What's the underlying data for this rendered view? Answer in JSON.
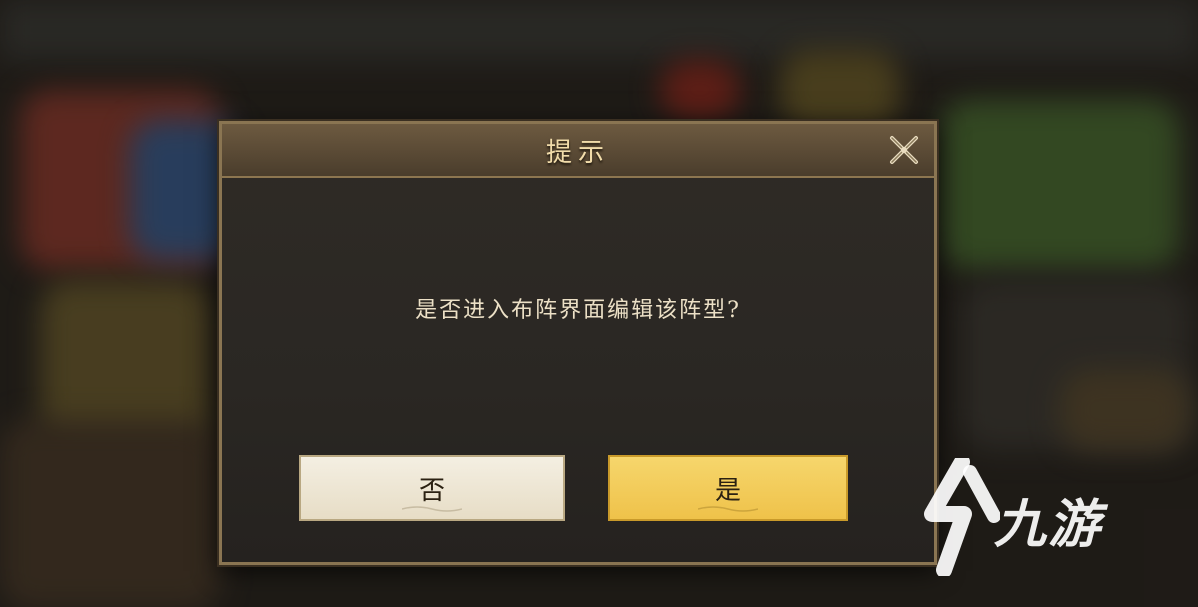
{
  "dialog": {
    "title": "提示",
    "message": "是否进入布阵界面编辑该阵型?",
    "close_icon": "close-x-icon",
    "no_label": "否",
    "yes_label": "是"
  },
  "watermark": {
    "text": "九游",
    "logo_icon": "jiuyou-logo-icon"
  },
  "colors": {
    "dialog_border": "#8a7552",
    "title_text": "#f1dcaa",
    "yes_button": "#f1c850",
    "no_button": "#efe8d8"
  }
}
